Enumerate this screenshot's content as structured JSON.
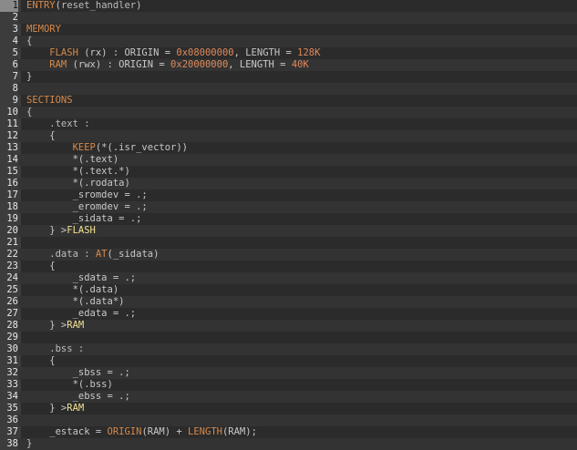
{
  "editor": {
    "lines": [
      [
        {
          "t": "ENTRY",
          "c": "kw"
        },
        {
          "t": "(",
          "c": "punc"
        },
        {
          "t": "reset_handler",
          "c": "id"
        },
        {
          "t": ")",
          "c": "punc"
        }
      ],
      [],
      [
        {
          "t": "MEMORY",
          "c": "kw"
        }
      ],
      [
        {
          "t": "{",
          "c": "punc"
        }
      ],
      [
        {
          "t": "    FLASH ",
          "c": "kw"
        },
        {
          "t": "(rx) : ORIGIN = ",
          "c": "plain"
        },
        {
          "t": "0x08000000",
          "c": "num"
        },
        {
          "t": ", LENGTH = ",
          "c": "plain"
        },
        {
          "t": "128K",
          "c": "num"
        }
      ],
      [
        {
          "t": "    RAM ",
          "c": "kw"
        },
        {
          "t": "(rwx) : ORIGIN = ",
          "c": "plain"
        },
        {
          "t": "0x20000000",
          "c": "num"
        },
        {
          "t": ", LENGTH = ",
          "c": "plain"
        },
        {
          "t": "40K",
          "c": "num"
        }
      ],
      [
        {
          "t": "}",
          "c": "punc"
        }
      ],
      [],
      [
        {
          "t": "SECTIONS",
          "c": "kw"
        }
      ],
      [
        {
          "t": "{",
          "c": "punc"
        }
      ],
      [
        {
          "t": "    .text :",
          "c": "id"
        }
      ],
      [
        {
          "t": "    {",
          "c": "punc"
        }
      ],
      [
        {
          "t": "        KEEP",
          "c": "kw"
        },
        {
          "t": "(*(.isr_vector))",
          "c": "plain"
        }
      ],
      [
        {
          "t": "        *(.text)",
          "c": "plain"
        }
      ],
      [
        {
          "t": "        *(.text.*)",
          "c": "plain"
        }
      ],
      [
        {
          "t": "        *(.rodata)",
          "c": "plain"
        }
      ],
      [
        {
          "t": "        _sromdev = .;",
          "c": "plain"
        }
      ],
      [
        {
          "t": "        _eromdev = .;",
          "c": "plain"
        }
      ],
      [
        {
          "t": "        _sidata = .;",
          "c": "plain"
        }
      ],
      [
        {
          "t": "    } >",
          "c": "plain"
        },
        {
          "t": "FLASH",
          "c": "ref"
        }
      ],
      [],
      [
        {
          "t": "    .data : ",
          "c": "id"
        },
        {
          "t": "AT",
          "c": "kw"
        },
        {
          "t": "(_sidata)",
          "c": "plain"
        }
      ],
      [
        {
          "t": "    {",
          "c": "punc"
        }
      ],
      [
        {
          "t": "        _sdata = .;",
          "c": "plain"
        }
      ],
      [
        {
          "t": "        *(.data)",
          "c": "plain"
        }
      ],
      [
        {
          "t": "        *(.data*)",
          "c": "plain"
        }
      ],
      [
        {
          "t": "        _edata = .;",
          "c": "plain"
        }
      ],
      [
        {
          "t": "    } >",
          "c": "plain"
        },
        {
          "t": "RAM",
          "c": "ref"
        }
      ],
      [],
      [
        {
          "t": "    .bss :",
          "c": "id"
        }
      ],
      [
        {
          "t": "    {",
          "c": "punc"
        }
      ],
      [
        {
          "t": "        _sbss = .;",
          "c": "plain"
        }
      ],
      [
        {
          "t": "        *(.bss)",
          "c": "plain"
        }
      ],
      [
        {
          "t": "        _ebss = .;",
          "c": "plain"
        }
      ],
      [
        {
          "t": "    } >",
          "c": "plain"
        },
        {
          "t": "RAM",
          "c": "ref"
        }
      ],
      [],
      [
        {
          "t": "    _estack = ",
          "c": "plain"
        },
        {
          "t": "ORIGIN",
          "c": "kw"
        },
        {
          "t": "(RAM) + ",
          "c": "plain"
        },
        {
          "t": "LENGTH",
          "c": "kw"
        },
        {
          "t": "(RAM);",
          "c": "plain"
        }
      ],
      [
        {
          "t": "}",
          "c": "punc"
        }
      ]
    ]
  }
}
